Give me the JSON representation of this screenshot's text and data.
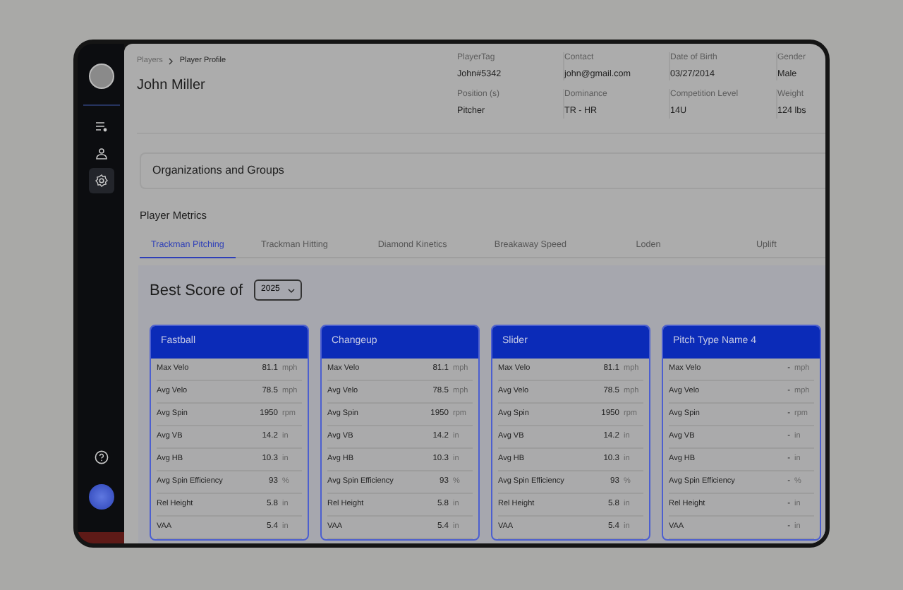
{
  "sidebar": {
    "nav": [
      {
        "kind": "list",
        "selected": false
      },
      {
        "kind": "people",
        "selected": false
      },
      {
        "kind": "settings",
        "selected": true
      }
    ]
  },
  "breadcrumb": [
    "Players",
    "Player Profile"
  ],
  "player_name": "John Miller",
  "info": [
    {
      "label": "PlayerTag",
      "value": "John#5342"
    },
    {
      "label": "Contact",
      "value": "john@gmail.com"
    },
    {
      "label": "Date of Birth",
      "value": "03/27/2014"
    },
    {
      "label": "Gender",
      "value": "Male"
    },
    {
      "label": "Position (s)",
      "value": "Pitcher"
    },
    {
      "label": "Dominance",
      "value": "TR - HR"
    },
    {
      "label": "Competition Level",
      "value": "14U"
    },
    {
      "label": "Weight",
      "value": "124 lbs"
    }
  ],
  "organizations_title": "Organizations and Groups",
  "metrics_title": "Player Metrics",
  "tabs": [
    {
      "label": "Trackman Pitching",
      "selected": true
    },
    {
      "label": "Trackman Hitting",
      "selected": false
    },
    {
      "label": "Diamond Kinetics",
      "selected": false
    },
    {
      "label": "Breakaway Speed",
      "selected": false
    },
    {
      "label": "Loden",
      "selected": false
    },
    {
      "label": "Uplift",
      "selected": false
    }
  ],
  "best_score": {
    "label": "Best Score of",
    "year": "2025"
  },
  "cards": [
    {
      "title": "Fastball",
      "rows": [
        [
          "Max Velo",
          "81.1",
          "mph"
        ],
        [
          "Avg Velo",
          "78.5",
          "mph"
        ],
        [
          "Avg Spin",
          "1950",
          "rpm"
        ],
        [
          "Avg VB",
          "14.2",
          "in"
        ],
        [
          "Avg HB",
          "10.3",
          "in"
        ],
        [
          "Avg Spin Efficiency",
          "93",
          "%"
        ],
        [
          "Rel Height",
          "5.8",
          "in"
        ],
        [
          "VAA",
          "5.4",
          "in"
        ]
      ]
    },
    {
      "title": "Changeup",
      "rows": [
        [
          "Max Velo",
          "81.1",
          "mph"
        ],
        [
          "Avg Velo",
          "78.5",
          "mph"
        ],
        [
          "Avg Spin",
          "1950",
          "rpm"
        ],
        [
          "Avg VB",
          "14.2",
          "in"
        ],
        [
          "Avg HB",
          "10.3",
          "in"
        ],
        [
          "Avg Spin Efficiency",
          "93",
          "%"
        ],
        [
          "Rel Height",
          "5.8",
          "in"
        ],
        [
          "VAA",
          "5.4",
          "in"
        ]
      ]
    },
    {
      "title": "Slider",
      "rows": [
        [
          "Max Velo",
          "81.1",
          "mph"
        ],
        [
          "Avg Velo",
          "78.5",
          "mph"
        ],
        [
          "Avg Spin",
          "1950",
          "rpm"
        ],
        [
          "Avg VB",
          "14.2",
          "in"
        ],
        [
          "Avg HB",
          "10.3",
          "in"
        ],
        [
          "Avg Spin Efficiency",
          "93",
          "%"
        ],
        [
          "Rel Height",
          "5.8",
          "in"
        ],
        [
          "VAA",
          "5.4",
          "in"
        ]
      ]
    },
    {
      "title": "Pitch Type Name 4",
      "rows": [
        [
          "Max Velo",
          "-",
          "mph"
        ],
        [
          "Avg Velo",
          "-",
          "mph"
        ],
        [
          "Avg Spin",
          "-",
          "rpm"
        ],
        [
          "Avg VB",
          "-",
          "in"
        ],
        [
          "Avg HB",
          "-",
          "in"
        ],
        [
          "Avg Spin Efficiency",
          "-",
          "%"
        ],
        [
          "Rel Height",
          "-",
          "in"
        ],
        [
          "VAA",
          "-",
          "in"
        ]
      ]
    }
  ]
}
